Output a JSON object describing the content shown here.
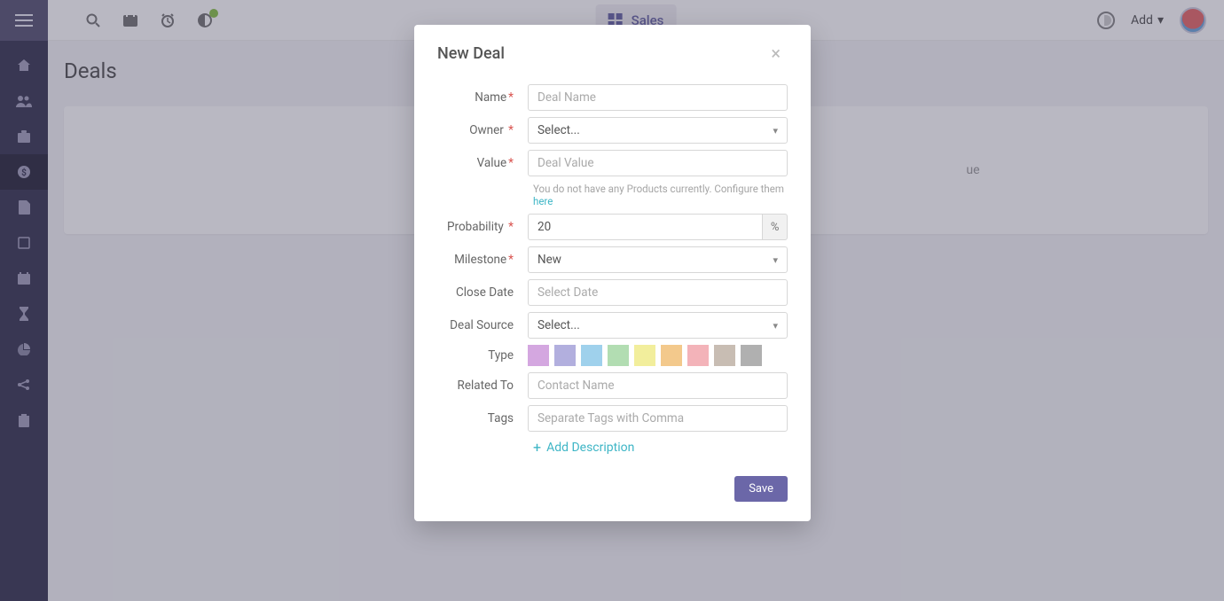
{
  "topbar": {
    "center_label": "Sales",
    "add_label": "Add"
  },
  "page": {
    "title": "Deals",
    "background_hint": "ue"
  },
  "modal": {
    "title": "New Deal",
    "save_label": "Save",
    "add_description_label": "Add Description",
    "products_hint_prefix": "You do not have any Products currently. Configure them ",
    "products_hint_link": "here"
  },
  "fields": {
    "name": {
      "label": "Name",
      "required": true,
      "placeholder": "Deal Name"
    },
    "owner": {
      "label": "Owner",
      "required": true,
      "selected": "Select..."
    },
    "value": {
      "label": "Value",
      "required": true,
      "placeholder": "Deal Value"
    },
    "probability": {
      "label": "Probability",
      "required": true,
      "value": "20",
      "suffix": "%"
    },
    "milestone": {
      "label": "Milestone",
      "required": true,
      "selected": "New"
    },
    "close_date": {
      "label": "Close Date",
      "required": false,
      "placeholder": "Select Date"
    },
    "deal_source": {
      "label": "Deal Source",
      "required": false,
      "selected": "Select..."
    },
    "type": {
      "label": "Type",
      "required": false
    },
    "related_to": {
      "label": "Related To",
      "required": false,
      "placeholder": "Contact Name"
    },
    "tags": {
      "label": "Tags",
      "required": false,
      "placeholder": "Separate Tags with Comma"
    }
  },
  "type_colors": [
    "#d4a7e0",
    "#b2afde",
    "#9fd1ec",
    "#b2ddb2",
    "#f2ee9c",
    "#f3c98c",
    "#f3b3b9",
    "#c8bdb3",
    "#b0b0b0"
  ]
}
